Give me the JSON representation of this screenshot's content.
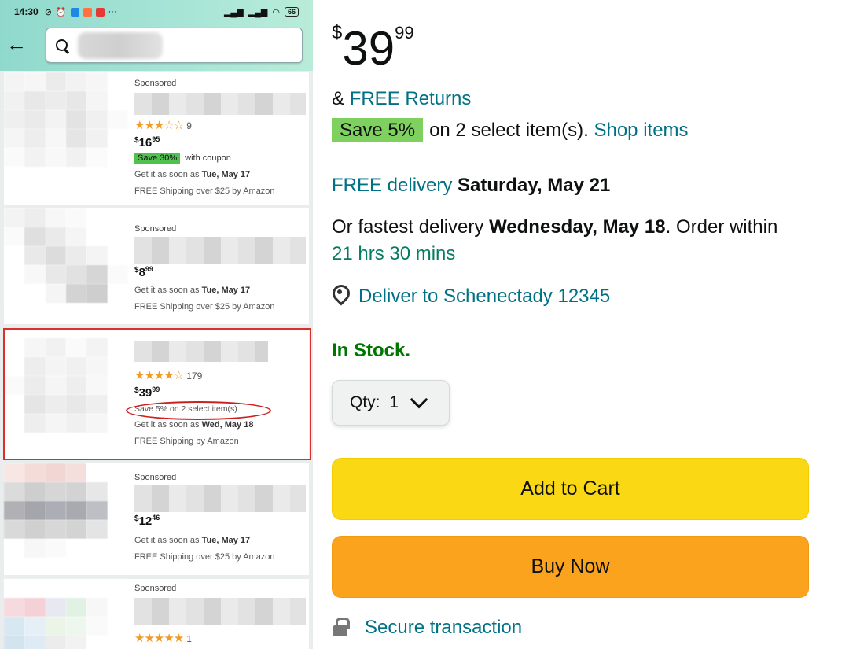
{
  "status_bar": {
    "time": "14:30",
    "battery": "66",
    "dots": "···"
  },
  "search": {
    "placeholder": ""
  },
  "results": [
    {
      "sponsored": "Sponsored",
      "stars": "★★★☆☆",
      "rating_count": "9",
      "price_symbol": "$",
      "price_whole": "16",
      "price_fraction": "95",
      "deal_badge": "Save 30%",
      "deal_text": "with coupon",
      "delivery_prefix": "Get it as soon as",
      "delivery_date": "Tue, May 17",
      "shipping": "FREE Shipping over $25 by Amazon"
    },
    {
      "sponsored": "Sponsored",
      "price_symbol": "$",
      "price_whole": "8",
      "price_fraction": "99",
      "delivery_prefix": "Get it as soon as",
      "delivery_date": "Tue, May 17",
      "shipping": "FREE Shipping over $25 by Amazon"
    },
    {
      "stars": "★★★★☆",
      "rating_count": "179",
      "price_symbol": "$",
      "price_whole": "39",
      "price_fraction": "99",
      "save_text": "Save 5% on 2 select item(s)",
      "delivery_prefix": "Get it as soon as",
      "delivery_date": "Wed, May 18",
      "shipping": "FREE Shipping by Amazon"
    },
    {
      "sponsored": "Sponsored",
      "price_symbol": "$",
      "price_whole": "12",
      "price_fraction": "46",
      "delivery_prefix": "Get it as soon as",
      "delivery_date": "Tue, May 17",
      "shipping": "FREE Shipping over $25 by Amazon"
    },
    {
      "sponsored": "Sponsored",
      "stars": "★★★★★",
      "rating_count": "1"
    }
  ],
  "detail": {
    "price_symbol": "$",
    "price_whole": "39",
    "price_fraction": "99",
    "returns_prefix": "&",
    "returns_link": "FREE Returns",
    "save_badge": "Save 5%",
    "save_text": "on 2 select item(s).",
    "shop_items": "Shop items",
    "free_delivery_label": "FREE delivery",
    "free_delivery_date": "Saturday, May 21",
    "fastest_prefix": "Or fastest delivery",
    "fastest_date": "Wednesday, May 18",
    "order_within": ". Order within",
    "countdown": "21 hrs 30 mins",
    "deliver_to": "Deliver to Schenectady 12345",
    "stock": "In Stock.",
    "qty_label": "Qty:",
    "qty_value": "1",
    "add_to_cart": "Add to Cart",
    "buy_now": "Buy Now",
    "secure": "Secure transaction"
  },
  "colors": {
    "teal_link": "#007185",
    "in_stock_green": "#007600",
    "add_to_cart_yellow": "#fad914",
    "buy_now_orange": "#fca31d",
    "save_badge_green": "#7fd15f",
    "annotation_red": "#d9302c"
  }
}
